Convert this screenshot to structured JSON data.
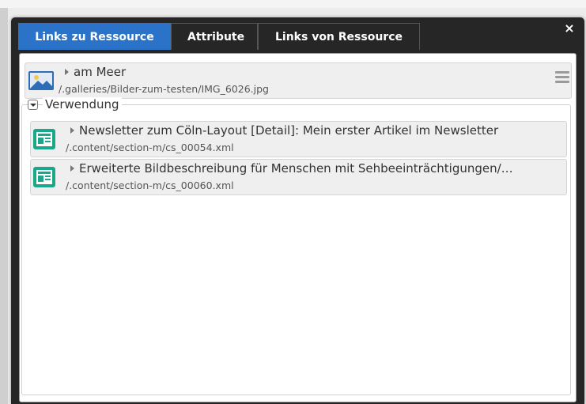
{
  "tabs": [
    {
      "label": "Links zu Ressource",
      "active": true
    },
    {
      "label": "Attribute",
      "active": false
    },
    {
      "label": "Links von Ressource",
      "active": false
    }
  ],
  "close_symbol": "×",
  "resource": {
    "title": "am Meer",
    "path": "/.galleries/Bilder-zum-testen/IMG_6026.jpg",
    "icon": "image-icon"
  },
  "usage": {
    "legend": "Verwendung",
    "items": [
      {
        "title": "Newsletter zum Cöln-Layout [Detail]: Mein erster Artikel im Newsletter",
        "path": "/.content/section-m/cs_00054.xml",
        "icon": "content-icon"
      },
      {
        "title": "Erweiterte Bildbeschreibung für Menschen mit Sehbeeinträchtigungen/…",
        "path": "/.content/section-m/cs_00060.xml",
        "icon": "content-icon"
      }
    ]
  },
  "colors": {
    "active_tab": "#2b73c8",
    "dialog_bg": "#262626",
    "content_icon": "#1aa88a"
  }
}
